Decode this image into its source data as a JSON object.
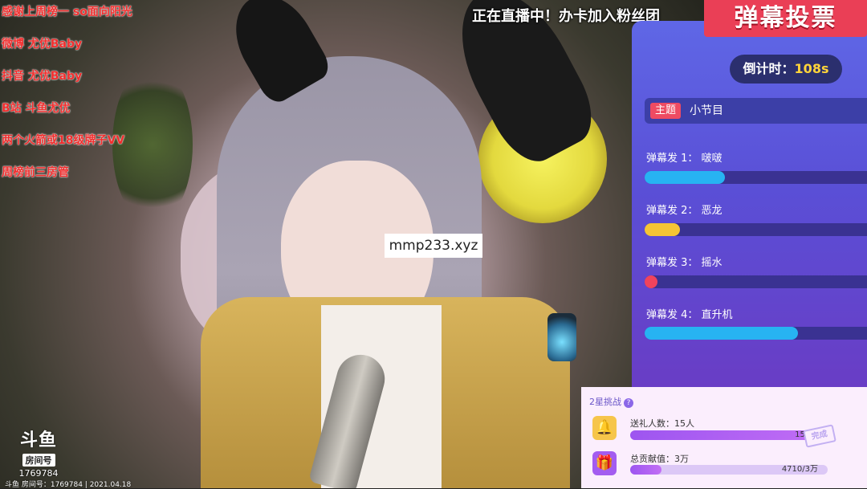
{
  "overlay_left": [
    "感谢上周榜一 so面向阳光",
    "微博 尤优Baby",
    "抖音 尤优Baby",
    "B站 斗鱼尤优",
    "两个火箭或18级牌子VV",
    "周榜前三房管"
  ],
  "ticker": "正在直播中！办卡加入粉丝团",
  "watermark": "mmp233.xyz",
  "logo": {
    "mark": "斗鱼",
    "room_label": "房间号",
    "room_number": "1769784"
  },
  "bottom_info": "斗鱼 房间号：1769784 | 2021.04.18",
  "vote": {
    "banner": "弹幕投票",
    "countdown_label": "倒计时：",
    "countdown_value": "108s",
    "topic_tag": "主题",
    "topic": "小节目",
    "options": [
      {
        "label": "弹幕发 1：  啵啵",
        "fraction": 0.36,
        "color": "#27b3f2"
      },
      {
        "label": "弹幕发 2：  恶龙",
        "fraction": 0.16,
        "color": "#f5c434"
      },
      {
        "label": "弹幕发 3：  摇水",
        "fraction": 0.05,
        "color": "#f0435d"
      },
      {
        "label": "弹幕发 4：  直升机",
        "fraction": 0.69,
        "color": "#27b3f2"
      }
    ]
  },
  "challenge": {
    "title": "2星挑战",
    "help_icon": "?",
    "rows": [
      {
        "icon": "bell-icon",
        "icon_glyph": "🔔",
        "label": "送礼人数：15人",
        "value": "15/15",
        "fraction": 1.0
      },
      {
        "icon": "gift-icon",
        "icon_glyph": "🎁",
        "label": "总贡献值：3万",
        "value": "4710/3万",
        "fraction": 0.16
      }
    ],
    "stamp": "完成"
  }
}
